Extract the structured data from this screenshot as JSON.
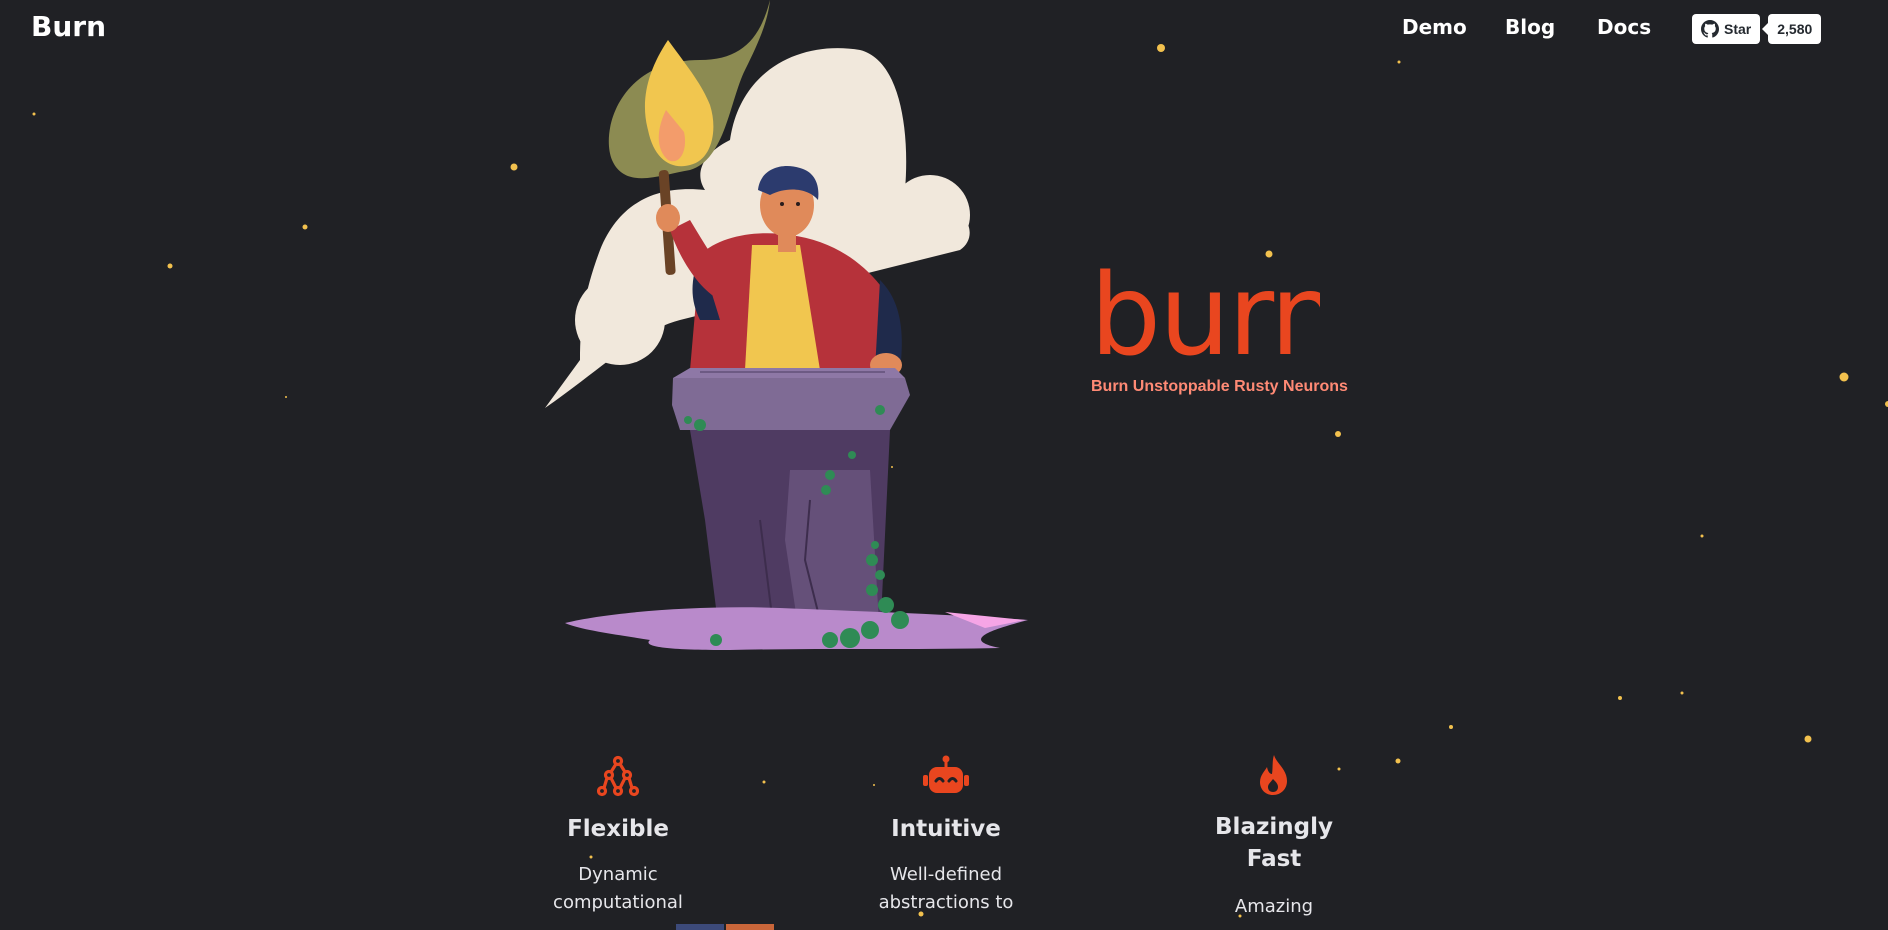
{
  "nav": {
    "brand": "Burn",
    "links": [
      "Demo",
      "Blog",
      "Docs"
    ],
    "github_star_label": "Star",
    "github_star_count": "2,580"
  },
  "hero": {
    "logo_text": "burn",
    "tagline": "Burn Unstoppable Rusty Neurons"
  },
  "features": [
    {
      "icon": "neural-network-icon",
      "title": "Flexible",
      "text_lines": [
        "Dynamic",
        "computational"
      ]
    },
    {
      "icon": "robot-icon",
      "title": "Intuitive",
      "text_lines": [
        "Well-defined",
        "abstractions to"
      ]
    },
    {
      "icon": "flame-icon",
      "title_lines": [
        "Blazingly",
        "Fast"
      ],
      "text_lines": [
        "Amazing"
      ]
    }
  ],
  "colors": {
    "background": "#202125",
    "accent": "#e9461f",
    "tagline": "#ff8a75",
    "star": "#f2c14e"
  }
}
